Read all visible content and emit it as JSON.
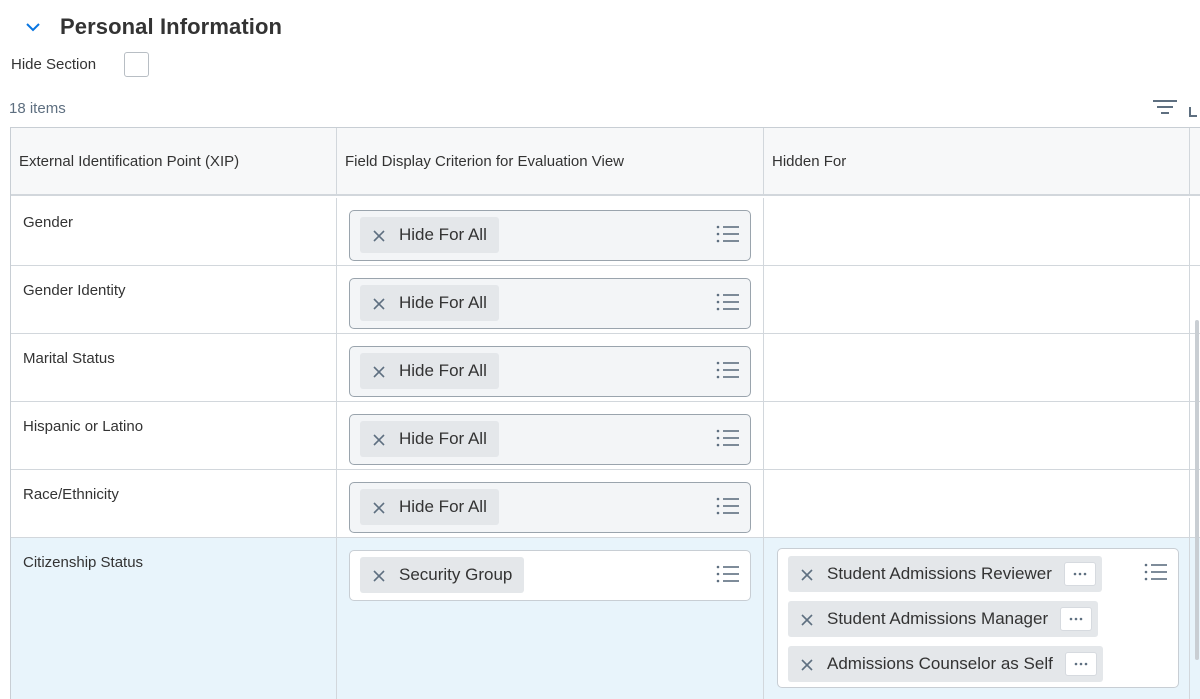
{
  "section": {
    "title": "Personal Information",
    "hide_label": "Hide Section"
  },
  "grid": {
    "count_label": "18 items",
    "columns": [
      "External Identification Point (XIP)",
      "Field Display Criterion for Evaluation View",
      "Hidden For"
    ],
    "rows": [
      {
        "xip": "Gender",
        "criterion": "Hide For All"
      },
      {
        "xip": "Gender Identity",
        "criterion": "Hide For All"
      },
      {
        "xip": "Marital Status",
        "criterion": "Hide For All"
      },
      {
        "xip": "Hispanic or Latino",
        "criterion": "Hide For All"
      },
      {
        "xip": "Race/Ethnicity",
        "criterion": "Hide For All"
      },
      {
        "xip": "Citizenship Status",
        "criterion": "Security Group",
        "hidden_for": [
          "Student Admissions Reviewer",
          "Student Admissions Manager",
          "Admissions Counselor as Self"
        ]
      }
    ]
  },
  "icons": {
    "chevron": "chevron-down-icon",
    "filter": "filter-icon",
    "list": "prompt-list-icon",
    "remove": "close-icon",
    "more": "more-icon"
  },
  "colors": {
    "accent": "#0875e1",
    "selected_row": "#e8f4fb",
    "pill": "#e4e7ea"
  }
}
